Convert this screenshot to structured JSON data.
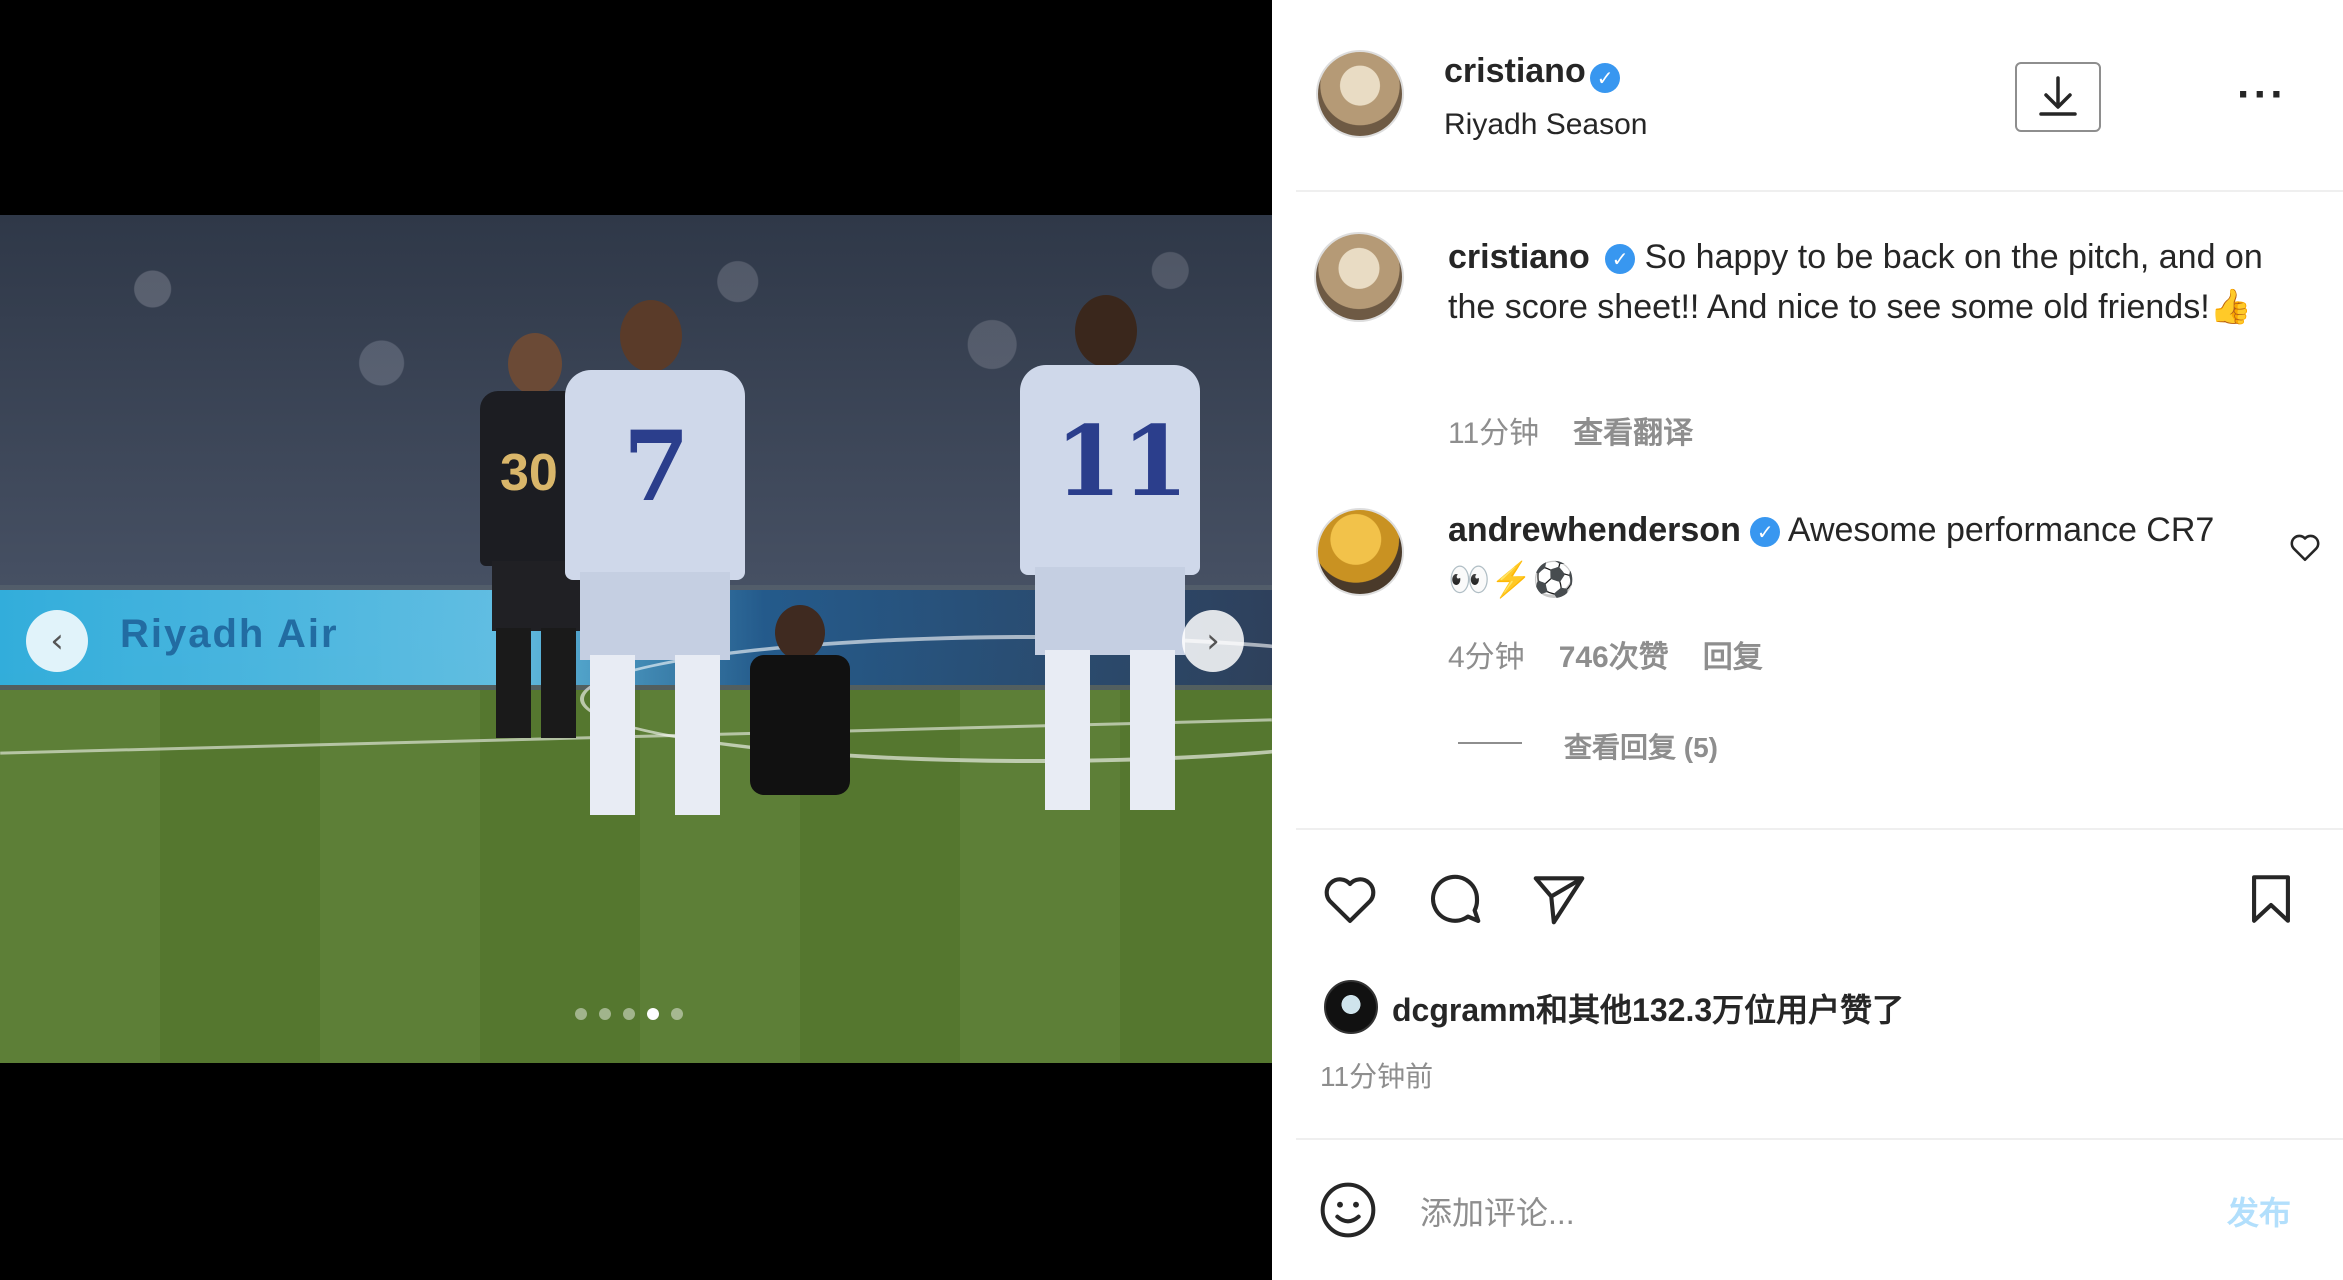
{
  "media": {
    "adboard_text": "Riyadh Air",
    "dark_player_number": "30",
    "white_player_number": "7",
    "white_player2_number": "11",
    "prev_icon": "chevron-left-icon",
    "next_icon": "chevron-right-icon",
    "carousel": {
      "count": 5,
      "active_index": 3
    }
  },
  "header": {
    "username": "cristiano",
    "location": "Riyadh Season",
    "download_icon": "download-icon",
    "more_icon": "more-horizontal-icon",
    "more_label": "···"
  },
  "caption": {
    "username": "cristiano",
    "text": "So happy to be back on the pitch, and on the score sheet!! And nice to see some old friends!👍",
    "time": "11分钟",
    "translate": "查看翻译"
  },
  "comment": {
    "username": "andrewhenderson",
    "text": "Awesome performance CR7 👀⚡⚽",
    "time": "4分钟",
    "likes": "746次赞",
    "reply": "回复",
    "view_replies": "查看回复 (5)"
  },
  "actions": {
    "like_icon": "heart-icon",
    "comment_icon": "comment-icon",
    "share_icon": "send-icon",
    "save_icon": "bookmark-icon"
  },
  "likes": {
    "text": "dcgramm和其他132.3万位用户赞了"
  },
  "post_time": "11分钟前",
  "composer": {
    "emoji_icon": "smile-icon",
    "placeholder": "添加评论...",
    "post_label": "发布"
  },
  "colors": {
    "verified": "#3897f0",
    "muted": "#8e8e8e",
    "post_button": "#b2dffc"
  }
}
